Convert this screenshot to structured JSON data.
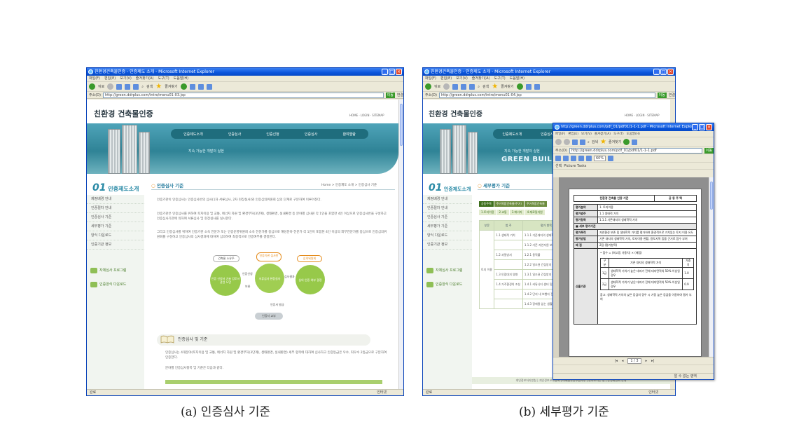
{
  "captions": {
    "a": "(a) 인증심사 기준",
    "b": "(b) 세부평가 기준"
  },
  "ie": {
    "left_title": "친환경건축물인증 - 인증제도 소개 - Microsoft Internet Explorer",
    "right_title": "친환경건축물인증 - 인증제도 소개 - Microsoft Internet Explorer",
    "pdf_title": "http://green.ddrplus.com/pdf_01/pdf01/1-1-1.pdf - Microsoft Internet Explorer",
    "menu": [
      "파일(F)",
      "편집(E)",
      "보기(V)",
      "즐겨찾기(A)",
      "도구(T)",
      "도움말(H)"
    ],
    "back": "뒤로",
    "search": "검색",
    "favorites": "즐겨찾기",
    "address_label": "주소(D)",
    "go": "이동",
    "links": "연결",
    "left_url": "http://green.ddrplus.com/intro/menu01-03.jsp",
    "right_url": "http://green.ddrplus.com/intro/menu01-04.jsp",
    "pdf_url": "http://green.ddrplus.com/pdf_01/pdf01/1-1-1.pdf",
    "status_done": "완료",
    "status_zone": "인터넷"
  },
  "site": {
    "logo": "친환경 건축물인증",
    "toplinks": "HOME · LOGIN · SITEMAP",
    "nav": [
      "인증제도소개",
      "인증심사",
      "인증신청",
      "인증심사",
      "참여열람"
    ],
    "slogan": "지속 가능한 개발의 실현",
    "green_building": "GREEN BUILDING",
    "side_number": "01",
    "side_title": "인증제도소개",
    "side_items": [
      "제정배경 안내",
      "인증절차 안내",
      "인증심사 기준",
      "세부평가 기준",
      "양식 다운로드",
      "인증기관 정보"
    ],
    "side_banner_1": "자체심사 프로그램",
    "side_banner_2": "인증양식 다운로드"
  },
  "left_page": {
    "section_title": "인증심사 기준",
    "breadcrumb": "Home > 인증제도 소개 > 인증심사 기준",
    "para1": "인증기관이 인증심사는 인증심사반의 심사(1차 서류심사, 2차 현장실사)와 인증심의위원회 심의 단계로 구분하여 이루어진다.",
    "para2": "인증기관은 인증심사를 위하여 토지이용 및 교통, 에너지 자원 및 환경부하(3단계), 생태환경, 실내환경 등 분야별 심사원 각 1인을 포함한 4인 이상으로 인증심사반을 구성하고 인증심사기관에 의하여 서류심사 및 현장실사를 실시한다.",
    "para3": "그리고 인증심사를 위하여 인증기관 소속 전문가 또는 인증운영위원회 소속 전문가를 중심으로 해당분야 전문가 각 1인이 포함된 4인 이상의 외부전문가를 중심으로 인증심의위원회를 구성하고 인증심사의 심사결과에 대하여 심의하여 최종적으로 인증여부를 결정한다.",
    "flow": {
      "top1": "건축물 소유주",
      "top2": "인증기관 심사반",
      "top3": "심의위원회",
      "c1": "인증 신청서 기술 검토서 관련 도면",
      "c2": "서류심사 현장실사",
      "c3": "심의 인증 여부 결정",
      "apply": "인증신청",
      "rev": "보완",
      "pass": "심사결과",
      "notice": "인증서 발급",
      "final": "인증서 교부"
    },
    "sub_title": "인증심사 및 기준",
    "sub_para": "인증심사는 4개분야(토지이용 및 교통, 에너지 자원 및 환경부하(3단계), 생태환경, 실내환경) 세부 항목에 대하여 심사하고 인증등급은 우수, 최우수 2등급으로 구분하여 인증한다.",
    "sub_para2": "분야별 인증심사항목 및 기준은 다음과 같다."
  },
  "right_page": {
    "section_title": "세부평가 기준",
    "tabs": [
      "공동주택",
      "주거복합건축물(주거)",
      "주거복합건축물"
    ],
    "subtabs": [
      "1.토지이용",
      "2.교통",
      "3.에너지",
      "4.재료및자원"
    ],
    "headers": [
      "부문",
      "범 주",
      "평가 항목"
    ],
    "rows": [
      [
        "1.1 생태적 가치",
        "1.1.1 기존대지의 생태학적 가치"
      ],
      [
        "",
        "1.1.2 기존 자연자원 보존"
      ],
      [
        "1.2 과밀방지",
        "1.2.1 용적률"
      ],
      [
        "",
        "1.2.2 일조권 간섭방지 대책"
      ],
      [
        "1.3 인접대지 영향",
        "1.3.1 일조권 간섭방지 대책"
      ],
      [
        "1.4 거주환경의 조성",
        "1.4.1 커뮤니티 센터 및 시설"
      ],
      [
        "",
        "1.4.2 단지 내 보행자 전용도로 조성"
      ],
      [
        "",
        "1.4.3 장애물 없는 생활환경"
      ]
    ],
    "side_label": "토지 이용",
    "footer": "개인정보처리방침 | 개인정보보호정책 | 이메일무단수집거부 | 찾아오시는 길 | 운영위원회 안내"
  },
  "pdf": {
    "menu": [
      "파일(F)",
      "편집(E)",
      "보기(V)",
      "즐겨찾기(A)",
      "도구(T)",
      "도움말(H)"
    ],
    "zoom": "60%",
    "select": "선택",
    "picture_tasks": "Picture Tasks",
    "page_num": "1",
    "page_total": "3",
    "doc_title": "친환경 건축물 인증 기준",
    "doc_kind": "공 동 주 택",
    "rows": [
      [
        "평가분야",
        "1. 토지이용"
      ],
      [
        "평가범주",
        "1.1 생태적 가치"
      ],
      [
        "평가항목",
        "1.1.1 기존대지의 생태학적 가치"
      ],
      [
        "■ 세부 평가기준",
        ""
      ],
      [
        "평가목적",
        "자연환경 보존 및 생태학적 가치를 평가하여 환경적으로 가치있는 토지 이용 유도"
      ],
      [
        "평가방법",
        "기존 대지의 생태학적 가치, 토지이용 현황, 용도지역 등을 근거로 점수 부여"
      ],
      [
        "배 점",
        "2점 (평가항목)"
      ]
    ],
    "formula": "• 점수 = (최고점 가중치) × (배점)",
    "inner_head": [
      "구분",
      "기존 대지의 생태학적 가치",
      "가중치"
    ],
    "inner_rows": [
      [
        "1급",
        "생태학적 가치가 높은 대지가 전체 대지면적의 50% 이상일 경우",
        "1.0"
      ],
      [
        "2급",
        "생태학적 가치가 낮은 대지가 전체 대지면적의 50% 이상일 경우",
        "0.9"
      ]
    ],
    "crit_label": "산출기준",
    "note": "참고: 생태학적 가치의 낮은 등급의 경우 시 가장 높은 등급을 이용하여 평가 부여",
    "status": "알 수 없는 영역",
    "nav_total": "1 / 3"
  }
}
